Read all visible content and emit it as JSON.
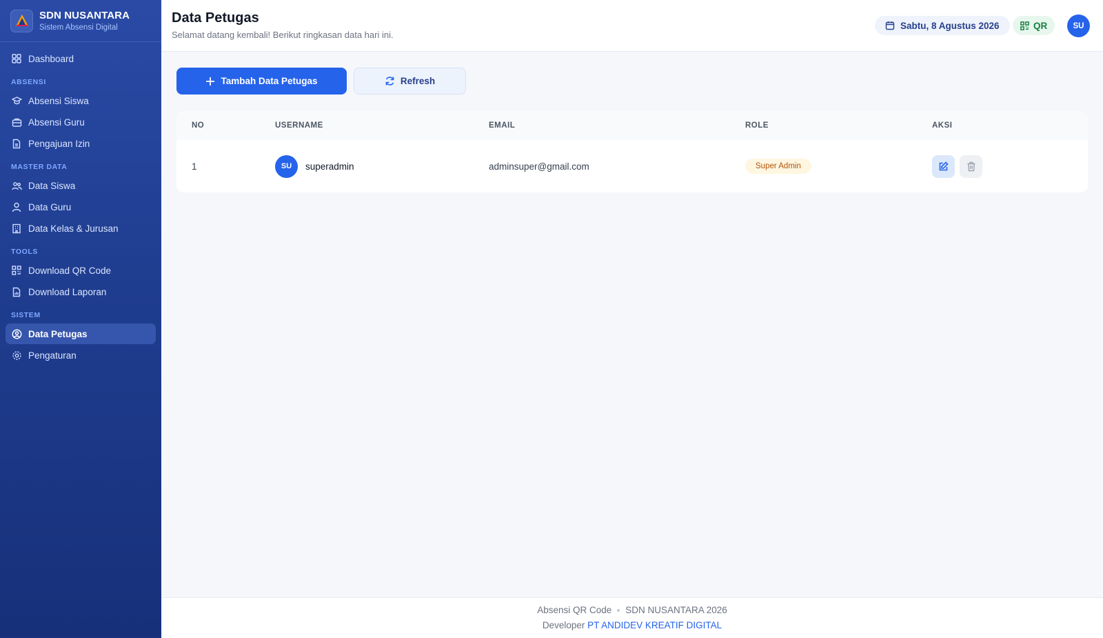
{
  "brand": {
    "name": "SDN NUSANTARA",
    "subtitle": "Sistem Absensi Digital"
  },
  "sidebar": {
    "dashboard": {
      "label": "Dashboard",
      "icon": "grid-icon"
    },
    "sections": [
      {
        "title": "ABSENSI",
        "items": [
          {
            "label": "Absensi Siswa",
            "icon": "student-hat-icon"
          },
          {
            "label": "Absensi Guru",
            "icon": "briefcase-icon"
          },
          {
            "label": "Pengajuan Izin",
            "icon": "document-icon"
          }
        ]
      },
      {
        "title": "MASTER DATA",
        "items": [
          {
            "label": "Data Siswa",
            "icon": "users-icon"
          },
          {
            "label": "Data Guru",
            "icon": "user-icon"
          },
          {
            "label": "Data Kelas & Jurusan",
            "icon": "building-icon"
          }
        ]
      },
      {
        "title": "TOOLS",
        "items": [
          {
            "label": "Download QR Code",
            "icon": "qr-code-icon"
          },
          {
            "label": "Download Laporan",
            "icon": "report-file-icon"
          }
        ]
      },
      {
        "title": "SISTEM",
        "items": [
          {
            "label": "Data Petugas",
            "icon": "user-circle-icon",
            "active": true
          },
          {
            "label": "Pengaturan",
            "icon": "gear-icon"
          }
        ]
      }
    ]
  },
  "header": {
    "title": "Data Petugas",
    "subtitle": "Selamat datang kembali! Berikut ringkasan data hari ini.",
    "date": "Sabtu, 8 Agustus 2026",
    "qr_label": "QR",
    "avatar_initials": "SU"
  },
  "toolbar": {
    "add_label": "Tambah Data Petugas",
    "refresh_label": "Refresh"
  },
  "table": {
    "headers": {
      "no": "NO",
      "username": "USERNAME",
      "email": "EMAIL",
      "role": "ROLE",
      "aksi": "AKSI"
    },
    "rows": [
      {
        "no": "1",
        "initials": "SU",
        "username": "superadmin",
        "email": "adminsuper@gmail.com",
        "role": "Super Admin"
      }
    ]
  },
  "footer": {
    "app": "Absensi QR Code",
    "copyright": "SDN NUSANTARA 2026",
    "developer_prefix": "Developer",
    "developer_name": "PT ANDIDEV KREATIF DIGITAL"
  },
  "colors": {
    "primary": "#2563eb",
    "sidebar": "#1f3d8f",
    "badge_bg": "#fef6e0",
    "badge_text": "#b45309",
    "qr_green": "#15803d"
  }
}
